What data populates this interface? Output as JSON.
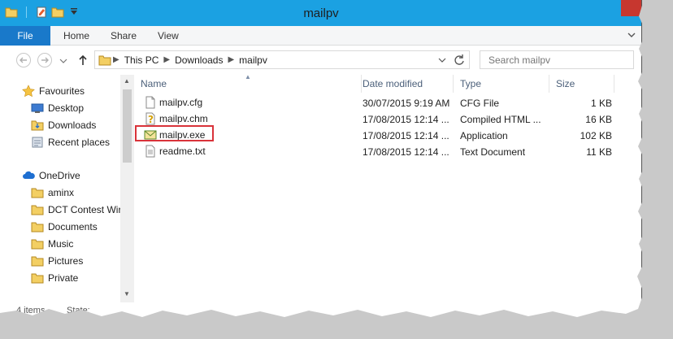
{
  "window": {
    "title": "mailpv"
  },
  "ribbon": {
    "tabs": [
      "File",
      "Home",
      "Share",
      "View"
    ]
  },
  "address": {
    "crumbs": [
      "This PC",
      "Downloads",
      "mailpv"
    ]
  },
  "search": {
    "placeholder": "Search mailpv"
  },
  "navpane": {
    "favourites_header": "Favourites",
    "favourites": [
      "Desktop",
      "Downloads",
      "Recent places"
    ],
    "onedrive_header": "OneDrive",
    "onedrive_items": [
      "aminx",
      "DCT Contest Wir",
      "Documents",
      "Music",
      "Pictures",
      "Private"
    ]
  },
  "columns": {
    "name": "Name",
    "date": "Date modified",
    "type": "Type",
    "size": "Size"
  },
  "files": [
    {
      "name": "mailpv.cfg",
      "date": "30/07/2015 9:19 AM",
      "type": "CFG File",
      "size": "1 KB",
      "icon": "cfg-file-icon"
    },
    {
      "name": "mailpv.chm",
      "date": "17/08/2015 12:14 ...",
      "type": "Compiled HTML ...",
      "size": "16 KB",
      "icon": "help-file-icon"
    },
    {
      "name": "mailpv.exe",
      "date": "17/08/2015 12:14 ...",
      "type": "Application",
      "size": "102 KB",
      "icon": "mail-app-icon"
    },
    {
      "name": "readme.txt",
      "date": "17/08/2015 12:14 ...",
      "type": "Text Document",
      "size": "11 KB",
      "icon": "text-file-icon"
    }
  ],
  "status": {
    "items": "4 items",
    "state": "State:"
  },
  "colors": {
    "titlebar": "#1ba1e2",
    "file_tab": "#1979ca",
    "close": "#c7372f",
    "highlight": "#d9333a",
    "folder": "#e8b84a"
  }
}
